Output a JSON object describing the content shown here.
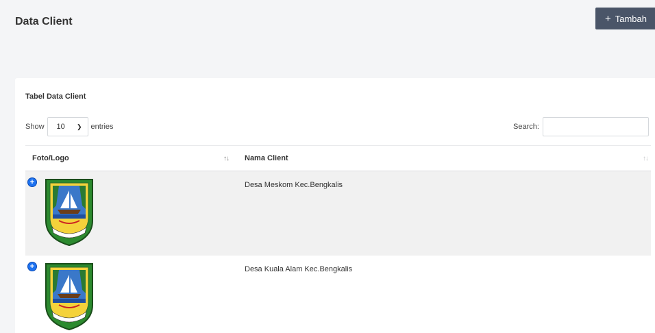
{
  "header": {
    "title": "Data Client",
    "add_button": {
      "icon": "plus-icon",
      "label": "Tambah"
    }
  },
  "card": {
    "title": "Tabel Data Client",
    "length": {
      "prefix": "Show",
      "selected": "10",
      "suffix": "entries"
    },
    "search": {
      "label": "Search:",
      "value": "",
      "placeholder": ""
    }
  },
  "table": {
    "columns": [
      {
        "label": "Foto/Logo",
        "sort": "asc"
      },
      {
        "label": "Nama Client",
        "sort": "none"
      }
    ],
    "rows": [
      {
        "logo": "kabupaten-bengkalis-logo",
        "name": "Desa Meskom Kec.Bengkalis"
      },
      {
        "logo": "kabupaten-bengkalis-logo",
        "name": "Desa Kuala Alam Kec.Bengkalis"
      }
    ]
  },
  "colors": {
    "accent_button": "#4a5568",
    "expand_icon": "#1d72f0",
    "row_stripe": "#f1f1f1"
  }
}
